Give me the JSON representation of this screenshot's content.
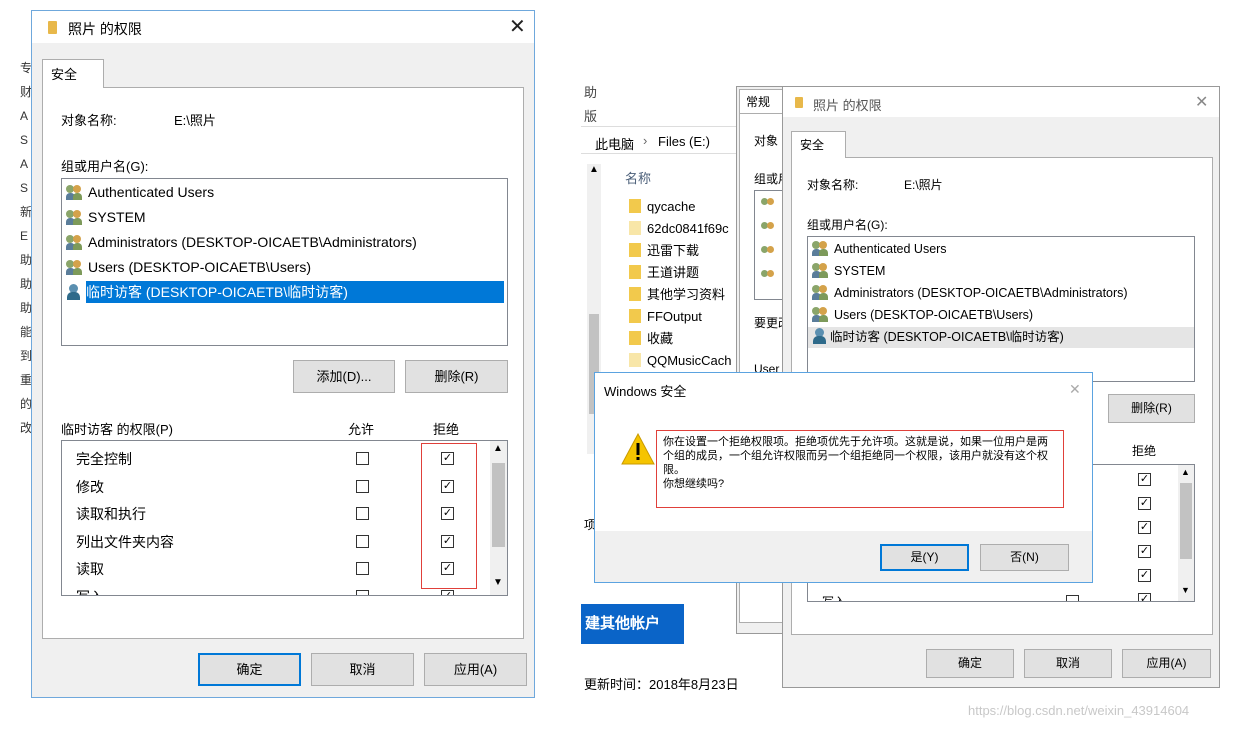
{
  "left_dialog": {
    "title": "照片 的权限",
    "tab": "安全",
    "object_label": "对象名称:",
    "object_value": "E:\\照片",
    "group_label": "组或用户名(G):",
    "users": [
      {
        "name": "Authenticated Users",
        "icon": "group-users-icon"
      },
      {
        "name": "SYSTEM",
        "icon": "group-users-icon"
      },
      {
        "name": "Administrators (DESKTOP-OICAETB\\Administrators)",
        "icon": "group-users-icon"
      },
      {
        "name": "Users (DESKTOP-OICAETB\\Users)",
        "icon": "group-users-icon"
      },
      {
        "name": "临时访客 (DESKTOP-OICAETB\\临时访客)",
        "icon": "single-user-icon",
        "selected": true
      }
    ],
    "add_button": "添加(D)...",
    "remove_button": "删除(R)",
    "perm_label": "临时访客 的权限(P)",
    "allow_header": "允许",
    "deny_header": "拒绝",
    "permissions": [
      {
        "name": "完全控制",
        "allow": false,
        "deny": true
      },
      {
        "name": "修改",
        "allow": false,
        "deny": true
      },
      {
        "name": "读取和执行",
        "allow": false,
        "deny": true
      },
      {
        "name": "列出文件夹内容",
        "allow": false,
        "deny": true
      },
      {
        "name": "读取",
        "allow": false,
        "deny": true
      },
      {
        "name": "写入",
        "allow": false,
        "deny": true
      }
    ],
    "ok_button": "确定",
    "cancel_button": "取消",
    "apply_button": "应用(A)"
  },
  "explorer": {
    "ribbon_fragment_1": "助",
    "ribbon_fragment_2": "版",
    "breadcrumb": [
      "此电脑",
      "Files (E:)"
    ],
    "column_header": "名称",
    "files": [
      {
        "name": "qycache",
        "light": false
      },
      {
        "name": "62dc0841f69c",
        "light": true
      },
      {
        "name": "迅雷下载",
        "light": false
      },
      {
        "name": "王道讲题",
        "light": false
      },
      {
        "name": "其他学习资料",
        "light": false
      },
      {
        "name": "FFOutput",
        "light": false
      },
      {
        "name": "收藏",
        "light": false
      },
      {
        "name": "QQMusicCach",
        "light": true
      }
    ],
    "fragment_item": "项",
    "blue_banner": "建其他帐户",
    "updated": "更新时间：2018年8月23日"
  },
  "mid_dialog": {
    "tab": "常规",
    "obj_fragment": "对象",
    "group_fragment": "组或用",
    "change_fragment": "要更改",
    "user_fragment": "User"
  },
  "right_dialog": {
    "title": "照片 的权限",
    "tab": "安全",
    "object_label": "对象名称:",
    "object_value": "E:\\照片",
    "group_label": "组或用户名(G):",
    "users": [
      {
        "name": "Authenticated Users",
        "icon": "group-users-icon"
      },
      {
        "name": "SYSTEM",
        "icon": "group-users-icon"
      },
      {
        "name": "Administrators (DESKTOP-OICAETB\\Administrators)",
        "icon": "group-users-icon"
      },
      {
        "name": "Users (DESKTOP-OICAETB\\Users)",
        "icon": "group-users-icon"
      },
      {
        "name": "临时访客 (DESKTOP-OICAETB\\临时访客)",
        "icon": "single-user-icon",
        "selected": true
      }
    ],
    "remove_button": "删除(R)",
    "deny_header": "拒绝",
    "perm_partial": "写入",
    "ok_button": "确定",
    "cancel_button": "取消",
    "apply_button": "应用(A)"
  },
  "alert": {
    "title": "Windows 安全",
    "message": "你在设置一个拒绝权限项。拒绝项优先于允许项。这就是说，如果一位用户是两个组的成员，一个组允许权限而另一个组拒绝同一个权限，该用户就没有这个权限。",
    "question": "你想继续吗?",
    "yes_button": "是(Y)",
    "no_button": "否(N)"
  },
  "left_edge_fragments": [
    "专",
    "财",
    "A",
    "S",
    "A",
    "S",
    "新",
    "E",
    "助",
    "助",
    "助",
    "能",
    "到",
    "重",
    "的",
    "改"
  ],
  "watermark": "https://blog.csdn.net/weixin_43914604",
  "colors": {
    "selection": "#0078d7",
    "highlight_box": "#e0403a",
    "banner": "#0a64c8",
    "warning": "#f5c400"
  }
}
